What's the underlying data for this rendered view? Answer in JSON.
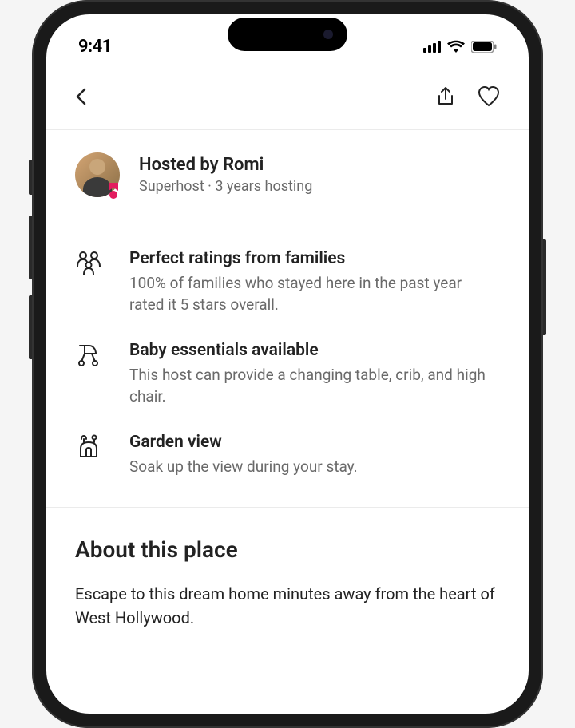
{
  "status": {
    "time": "9:41"
  },
  "host": {
    "title": "Hosted by Romi",
    "subtitle": "Superhost · 3 years hosting"
  },
  "highlights": [
    {
      "title": "Perfect ratings from families",
      "desc": "100% of families who stayed here in the past year rated it 5 stars overall."
    },
    {
      "title": "Baby essentials available",
      "desc": "This host can provide a changing table, crib, and high chair."
    },
    {
      "title": "Garden view",
      "desc": "Soak up the view during your stay."
    }
  ],
  "about": {
    "heading": "About this place",
    "body": "Escape to this dream home minutes away from the heart of West Hollywood."
  }
}
